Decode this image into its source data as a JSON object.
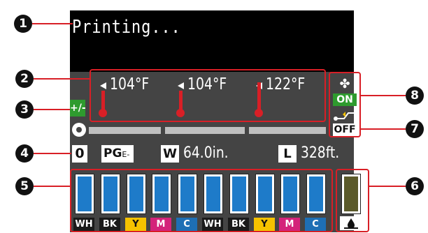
{
  "status": {
    "text": "Printing..."
  },
  "callouts": [
    "1",
    "2",
    "3",
    "4",
    "5",
    "6",
    "7",
    "8"
  ],
  "temperatures": [
    "104°F",
    "104°F",
    "122°F"
  ],
  "adjust": {
    "label": "+/-"
  },
  "fan": {
    "state": "ON",
    "icon": "fan-icon"
  },
  "take_up": {
    "state": "OFF",
    "icon": "take-up-reel-icon"
  },
  "media": {
    "remaining": "0",
    "pg_label": "PG",
    "pg_suffix": "E-",
    "width_tag": "W",
    "width_value": "64.0in.",
    "length_tag": "L",
    "length_value": "328ft."
  },
  "ink_cartridges": [
    {
      "label": "WH",
      "fill_color": "#1e7bc9",
      "label_bg": "#1a1a1a",
      "label_color": "#ffffff"
    },
    {
      "label": "BK",
      "fill_color": "#1e7bc9",
      "label_bg": "#1a1a1a",
      "label_color": "#ffffff"
    },
    {
      "label": "Y",
      "fill_color": "#1e7bc9",
      "label_bg": "#f5c200",
      "label_color": "#111111"
    },
    {
      "label": "M",
      "fill_color": "#1e7bc9",
      "label_bg": "#d4237a",
      "label_color": "#ffffff"
    },
    {
      "label": "C",
      "fill_color": "#1e7bc9",
      "label_bg": "#1e6fb5",
      "label_color": "#ffffff"
    },
    {
      "label": "WH",
      "fill_color": "#1e7bc9",
      "label_bg": "#1a1a1a",
      "label_color": "#ffffff"
    },
    {
      "label": "BK",
      "fill_color": "#1e7bc9",
      "label_bg": "#1a1a1a",
      "label_color": "#ffffff"
    },
    {
      "label": "Y",
      "fill_color": "#1e7bc9",
      "label_bg": "#f5c200",
      "label_color": "#111111"
    },
    {
      "label": "M",
      "fill_color": "#1e7bc9",
      "label_bg": "#d4237a",
      "label_color": "#ffffff"
    },
    {
      "label": "C",
      "fill_color": "#1e7bc9",
      "label_bg": "#1e6fb5",
      "label_color": "#ffffff"
    }
  ],
  "waste_ink": {
    "fill_color": "#5b5a2a",
    "icon": "ink-drop-icon"
  },
  "colors": {
    "accent": "#d81f26",
    "panel": "#444444",
    "fan_on": "#2e9b2e"
  }
}
